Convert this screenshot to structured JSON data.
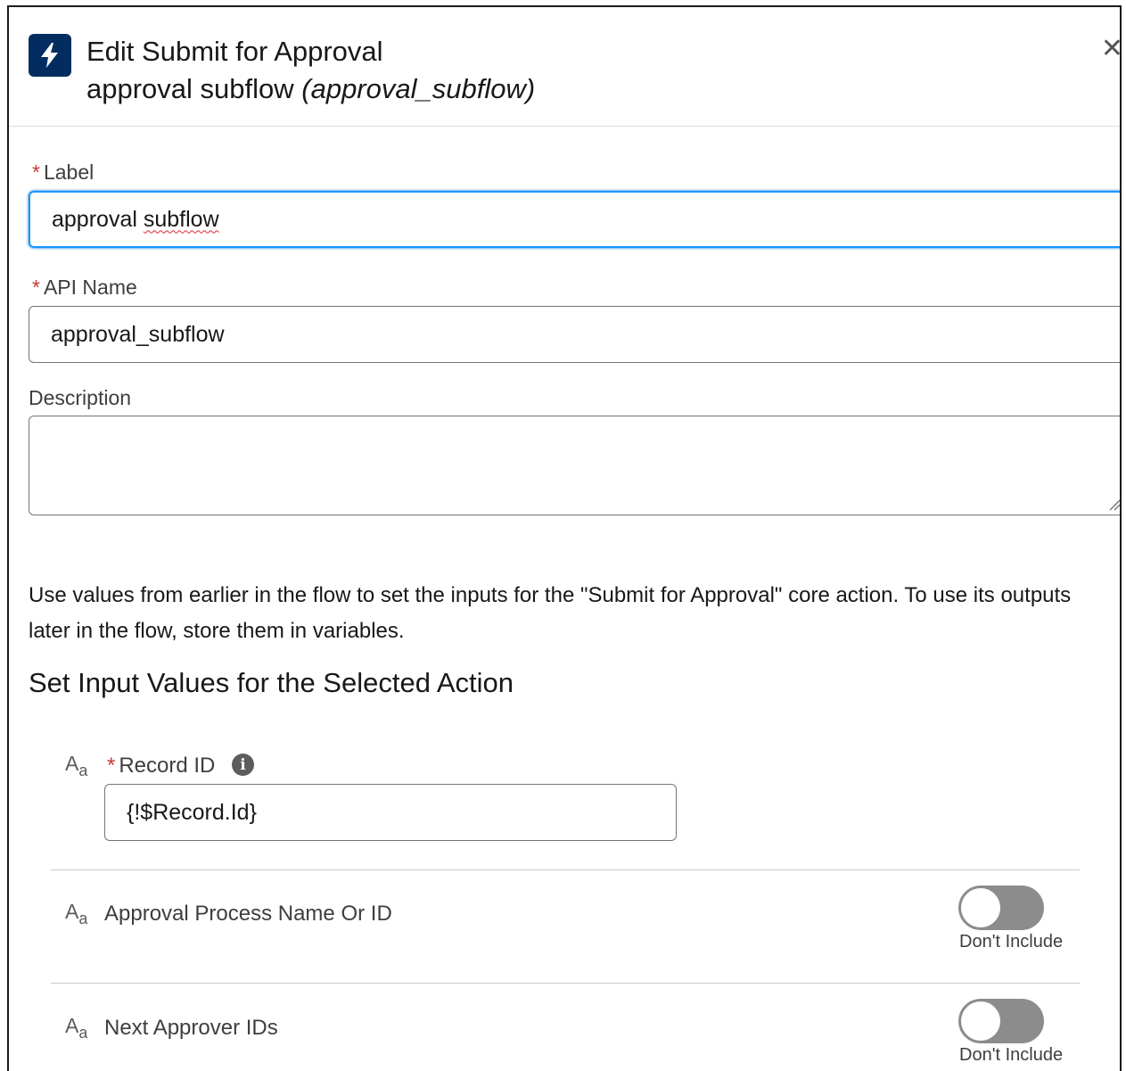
{
  "header": {
    "title": "Edit Submit for Approval",
    "element_label": "approval subflow",
    "element_api": "(approval_subflow)",
    "icon": "lightning-bolt-icon",
    "close_icon": "close-icon"
  },
  "fields": {
    "required_mark": "*",
    "label": {
      "label": "Label",
      "value": "approval subflow",
      "value_part1": "approval ",
      "value_part2": "subflow"
    },
    "api_name": {
      "label": "API Name",
      "value": "approval_subflow"
    },
    "description": {
      "label": "Description",
      "value": ""
    }
  },
  "help_text": "Use values from earlier in the flow to set the inputs for the \"Submit for Approval\" core action. To use its outputs later in the flow, store them in variables.",
  "section_title": "Set Input Values for the Selected Action",
  "inputs": {
    "type_icon_main": "A",
    "type_icon_sub": "a",
    "record_id": {
      "label": "Record ID",
      "value": "{!$Record.Id}",
      "info_icon": "i"
    },
    "approval_process": {
      "label": "Approval Process Name Or ID",
      "toggle_state": "Don't Include"
    },
    "next_approver": {
      "label": "Next Approver IDs",
      "toggle_state": "Don't Include"
    }
  },
  "colors": {
    "brand_dark": "#032d60",
    "focus_blue": "#1b96ff",
    "required_red": "#c23934",
    "toggle_off": "#8c8c8c"
  }
}
